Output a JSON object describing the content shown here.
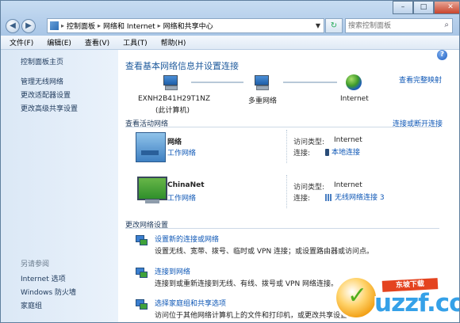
{
  "titlebar": {
    "window_controls": {
      "minimize": "–",
      "maximize": "□",
      "close": "✕"
    },
    "breadcrumb": [
      "控制面板",
      "网络和 Internet",
      "网络和共享中心"
    ],
    "search_placeholder": "搜索控制面板"
  },
  "menu": [
    "文件(F)",
    "编辑(E)",
    "查看(V)",
    "工具(T)",
    "帮助(H)"
  ],
  "sidebar": {
    "items": [
      "控制面板主页",
      "管理无线网络",
      "更改适配器设置",
      "更改高级共享设置"
    ],
    "see_also_header": "另请参阅",
    "see_also": [
      "Internet 选项",
      "Windows 防火墙",
      "家庭组"
    ]
  },
  "main": {
    "help_icon": "?",
    "title": "查看基本网络信息并设置连接",
    "view_full_map": "查看完整映射",
    "map": {
      "computer_name": "EXNH2B41H29T1NZ",
      "computer_sub": "(此计算机)",
      "network": "多重网络",
      "internet": "Internet"
    },
    "active_header": "查看活动网络",
    "connect_disconnect": "连接或断开连接",
    "networks": [
      {
        "name": "网络",
        "type": "工作网络",
        "access_label": "访问类型:",
        "access_value": "Internet",
        "conn_label": "连接:",
        "conn_value": "本地连接"
      },
      {
        "name": "ChinaNet",
        "type": "工作网络",
        "access_label": "访问类型:",
        "access_value": "Internet",
        "conn_label": "连接:",
        "conn_value": "无线网络连接 3"
      }
    ],
    "change_header": "更改网络设置",
    "tasks": [
      {
        "link": "设置新的连接或网络",
        "desc": "设置无线、宽带、拨号、临时或 VPN 连接；或设置路由器或访问点。"
      },
      {
        "link": "连接到网络",
        "desc": "连接到或重新连接到无线、有线、拨号或 VPN 网络连接。"
      },
      {
        "link": "选择家庭组和共享选项",
        "desc": "访问位于其他网络计算机上的文件和打印机，或更改共享设置。"
      }
    ]
  },
  "watermark": {
    "ribbon": "东坡下载",
    "brand": "uzzf.com"
  }
}
